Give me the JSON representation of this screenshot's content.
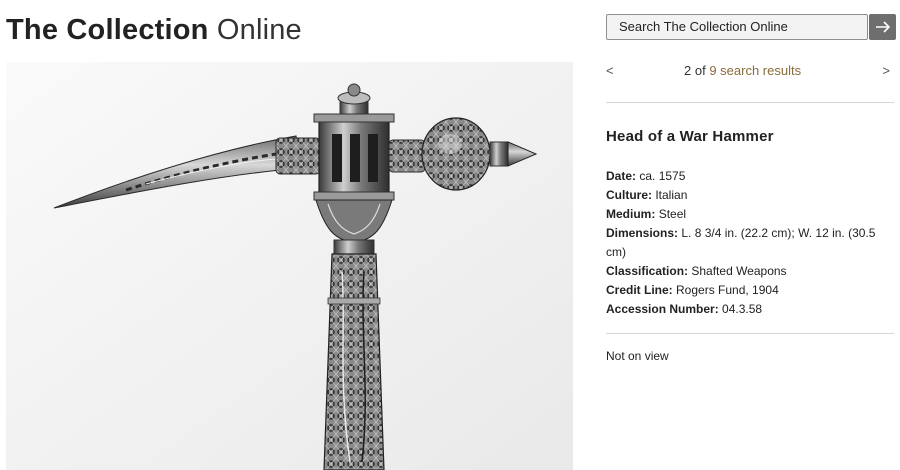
{
  "header": {
    "title_bold": "The Collection",
    "title_light": "Online"
  },
  "search": {
    "placeholder": "Search The Collection Online",
    "submit_icon": "arrow-right-icon"
  },
  "image": {
    "subject": "war-hammer-head"
  },
  "pager": {
    "prev": "<",
    "current": "2",
    "of_text": "of",
    "results_link": "9 search results",
    "next": ">"
  },
  "object": {
    "title": "Head of a War Hammer",
    "facts": [
      {
        "label": "Date:",
        "value": "ca. 1575"
      },
      {
        "label": "Culture:",
        "value": "Italian"
      },
      {
        "label": "Medium:",
        "value": "Steel"
      },
      {
        "label": "Dimensions:",
        "value": "L. 8 3/4 in. (22.2 cm); W. 12 in. (30.5 cm)"
      },
      {
        "label": "Classification:",
        "value": "Shafted Weapons"
      },
      {
        "label": "Credit Line:",
        "value": "Rogers Fund, 1904"
      },
      {
        "label": "Accession Number:",
        "value": "04.3.58"
      }
    ],
    "on_view": "Not on view"
  },
  "colors": {
    "link": "#8a6a3a",
    "button": "#6e6e6e"
  }
}
